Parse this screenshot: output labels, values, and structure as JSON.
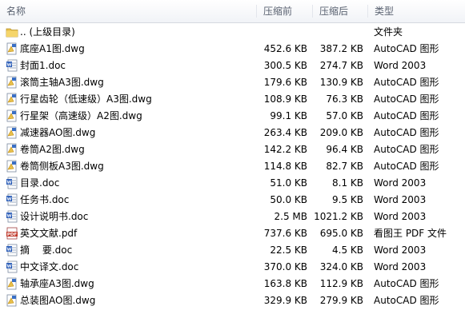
{
  "columns": {
    "name": "名称",
    "compressed_before": "压缩前",
    "compressed_after": "压缩后",
    "type": "类型"
  },
  "files": [
    {
      "name": ".. (上级目录)",
      "before": "",
      "after": "",
      "type": "文件夹",
      "icon": "folder-icon"
    },
    {
      "name": "底座A1图.dwg",
      "before": "452.6 KB",
      "after": "387.2 KB",
      "type": "AutoCAD 图形",
      "icon": "dwg-file-icon"
    },
    {
      "name": "封面1.doc",
      "before": "300.5 KB",
      "after": "274.7 KB",
      "type": "Word 2003",
      "icon": "word-doc-icon"
    },
    {
      "name": "滚筒主轴A3图.dwg",
      "before": "179.6 KB",
      "after": "130.9 KB",
      "type": "AutoCAD 图形",
      "icon": "dwg-file-icon"
    },
    {
      "name": "行星齿轮（低速级）A3图.dwg",
      "before": "108.9 KB",
      "after": "76.3 KB",
      "type": "AutoCAD 图形",
      "icon": "dwg-file-icon"
    },
    {
      "name": "行星架（高速级）A2图.dwg",
      "before": "99.1 KB",
      "after": "57.0 KB",
      "type": "AutoCAD 图形",
      "icon": "dwg-file-icon"
    },
    {
      "name": "减速器AO图.dwg",
      "before": "263.4 KB",
      "after": "209.0 KB",
      "type": "AutoCAD 图形",
      "icon": "dwg-file-icon"
    },
    {
      "name": "卷筒A2图.dwg",
      "before": "142.2 KB",
      "after": "96.4 KB",
      "type": "AutoCAD 图形",
      "icon": "dwg-file-icon"
    },
    {
      "name": "卷筒侧板A3图.dwg",
      "before": "114.8 KB",
      "after": "82.7 KB",
      "type": "AutoCAD 图形",
      "icon": "dwg-file-icon"
    },
    {
      "name": "目录.doc",
      "before": "51.0 KB",
      "after": "8.1 KB",
      "type": "Word 2003",
      "icon": "word-doc-icon"
    },
    {
      "name": "任务书.doc",
      "before": "50.0 KB",
      "after": "9.5 KB",
      "type": "Word 2003",
      "icon": "word-doc-icon"
    },
    {
      "name": "设计说明书.doc",
      "before": "2.5 MB",
      "after": "1021.2 KB",
      "type": "Word 2003",
      "icon": "word-doc-icon"
    },
    {
      "name": "英文文献.pdf",
      "before": "737.6 KB",
      "after": "695.0 KB",
      "type": "看图王 PDF 文件",
      "icon": "pdf-file-icon"
    },
    {
      "name": "摘　 要.doc",
      "before": "22.5 KB",
      "after": "4.5 KB",
      "type": "Word 2003",
      "icon": "word-doc-icon"
    },
    {
      "name": "中文译文.doc",
      "before": "370.0 KB",
      "after": "324.0 KB",
      "type": "Word 2003",
      "icon": "word-doc-icon"
    },
    {
      "name": "轴承座A3图.dwg",
      "before": "163.8 KB",
      "after": "112.9 KB",
      "type": "AutoCAD 图形",
      "icon": "dwg-file-icon"
    },
    {
      "name": "总装图AO图.dwg",
      "before": "329.9 KB",
      "after": "279.9 KB",
      "type": "AutoCAD 图形",
      "icon": "dwg-file-icon"
    }
  ]
}
